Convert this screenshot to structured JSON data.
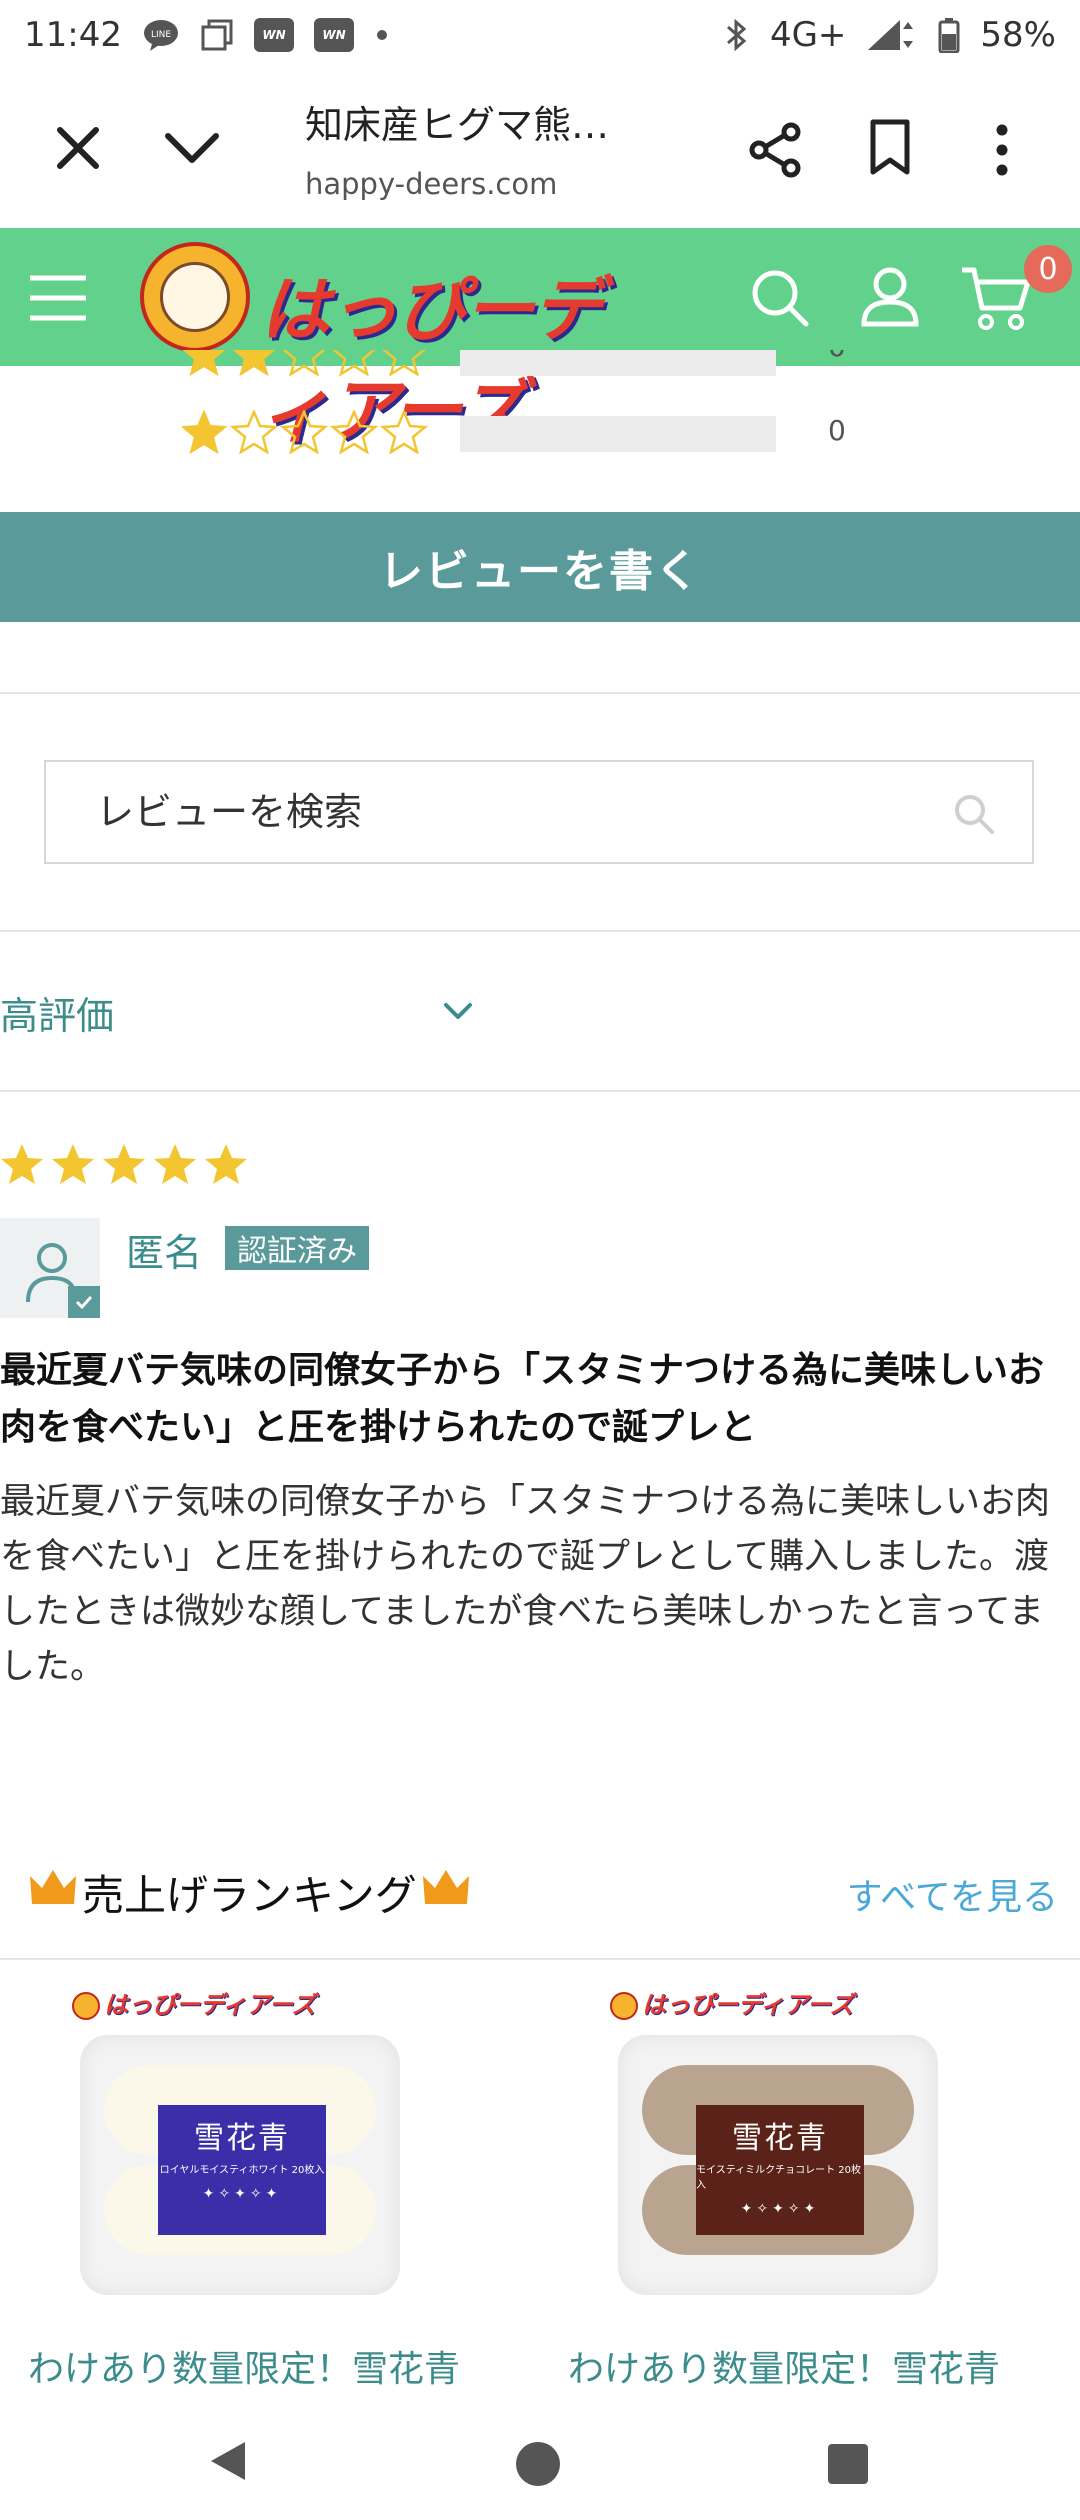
{
  "status_bar": {
    "time": "11:42",
    "network": "4G+",
    "battery": "58%"
  },
  "browser": {
    "page_title": "知床産ヒグマ熊…",
    "domain": "happy-deers.com"
  },
  "site": {
    "logo_text": "はっぴーディアーズ",
    "cart_count": "0",
    "header_color": "#62d18b",
    "accent_color": "#5a9a9a"
  },
  "rating_rows": [
    {
      "count": "0"
    },
    {
      "count": "0"
    }
  ],
  "write_review_label": "レビューを書く",
  "review_search": {
    "placeholder": "レビューを検索"
  },
  "sort": {
    "selected": "高評価"
  },
  "review": {
    "stars": 5,
    "reviewer": "匿名",
    "verified": "認証済み",
    "title": "最近夏バテ気味の同僚女子から「スタミナつける為に美味しいお肉を食べたい」と圧を掛けられたので誕プレと",
    "body": "最近夏バテ気味の同僚女子から「スタミナつける為に美味しいお肉を食べたい」と圧を掛けられたので誕プレとして購入しました。渡したときは微妙な顔してましたが食べたら美味しかったと言ってました。"
  },
  "ranking": {
    "title": "売上げランキング",
    "see_all": "すべてを見る",
    "products": [
      {
        "name": "わけあり数量限定！雪花青",
        "pack_label": "雪花青",
        "pack_sub": "ロイヤルモイスティホワイト 20枚入",
        "mini_logo": "はっぴーディアーズ"
      },
      {
        "name": "わけあり数量限定！雪花青",
        "pack_label": "雪花青",
        "pack_sub": "モイスティミルクチョコレート 20枚入",
        "mini_logo": "はっぴーディアーズ"
      }
    ]
  }
}
